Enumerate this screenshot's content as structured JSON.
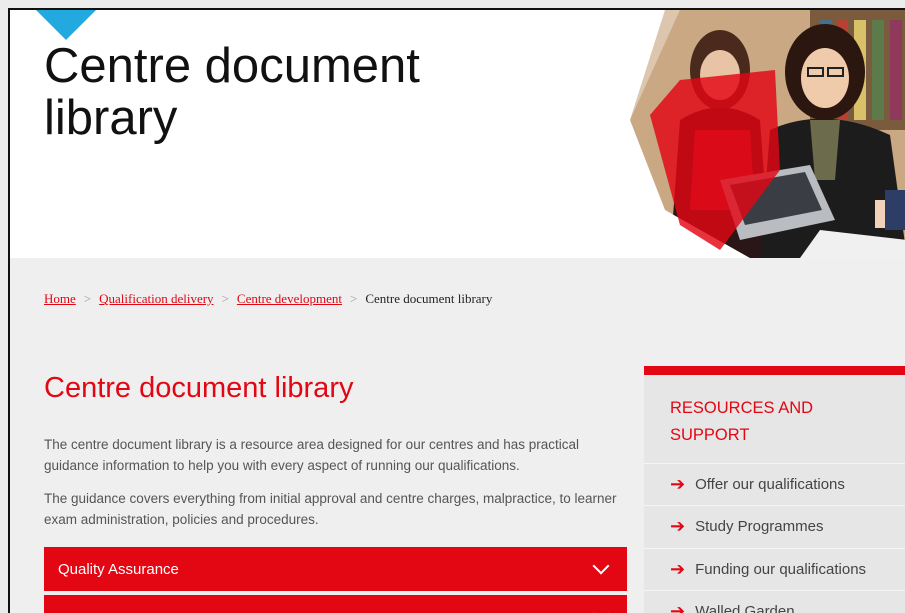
{
  "hero": {
    "title": "Centre document library"
  },
  "breadcrumb": {
    "items": [
      "Home",
      "Qualification delivery",
      "Centre development"
    ],
    "current": "Centre document library"
  },
  "main": {
    "heading": "Centre document library",
    "paragraphs": [
      "The centre document library is a resource area designed for our centres and has practical guidance information to help you with every aspect of running our qualifications.",
      "The guidance covers everything from initial approval and centre charges, malpractice, to learner exam administration, policies and procedures."
    ],
    "accordion": [
      {
        "label": "Quality Assurance"
      },
      {
        "label": ""
      }
    ]
  },
  "sidebar": {
    "title": "RESOURCES AND SUPPORT",
    "items": [
      {
        "label": "Offer our qualifications"
      },
      {
        "label": "Study Programmes"
      },
      {
        "label": "Funding our qualifications"
      },
      {
        "label": "Walled Garden"
      }
    ]
  },
  "colors": {
    "brand_red": "#e30613",
    "accent_blue": "#21a9e0"
  },
  "icons": {
    "breadcrumb_separator": "chevron-right-icon",
    "accordion_toggle": "chevron-down-icon",
    "sidebar_link": "arrow-right-icon"
  }
}
